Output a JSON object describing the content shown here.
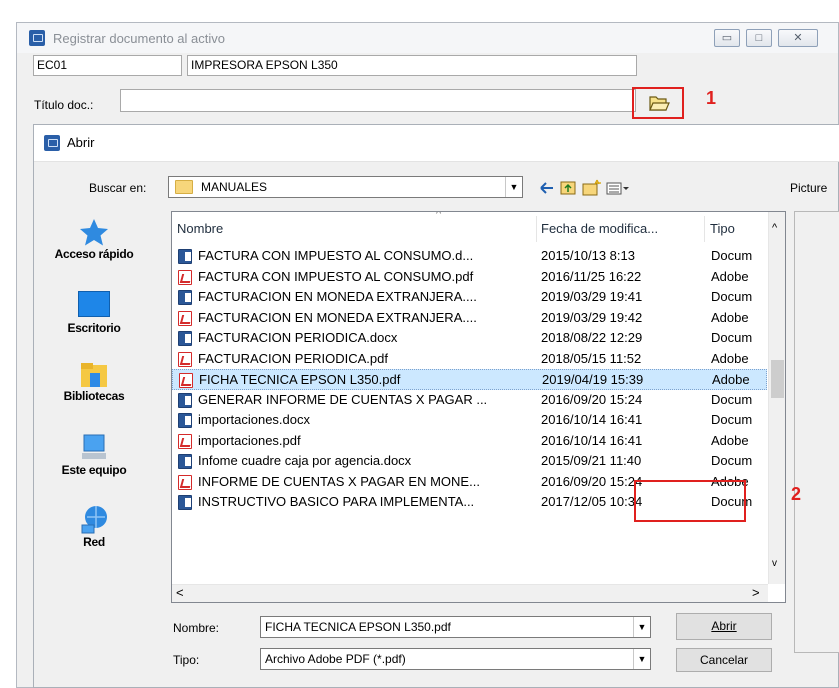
{
  "outer": {
    "title": "Registrar documento al activo",
    "code_value": "EC01",
    "description_value": "IMPRESORA EPSON L350",
    "title_doc_label": "Título doc.:",
    "title_doc_value": "",
    "caption_minimize": "▭",
    "caption_maximize": "□",
    "caption_close": "✕",
    "callout_1": "1",
    "callout_2": "2"
  },
  "dialog": {
    "title": "Abrir",
    "look_in_label": "Buscar en:",
    "look_in_value": "MANUALES",
    "preview_label": "Picture",
    "places": [
      {
        "label": "Acceso rápido",
        "icon": "star-icon"
      },
      {
        "label": "Escritorio",
        "icon": "desktop-icon"
      },
      {
        "label": "Bibliotecas",
        "icon": "libraries-icon"
      },
      {
        "label": "Este equipo",
        "icon": "computer-icon"
      },
      {
        "label": "Red",
        "icon": "network-icon"
      }
    ],
    "columns": {
      "name": "Nombre",
      "date": "Fecha de modifica...",
      "type": "Tipo"
    },
    "files": [
      {
        "name": "FACTURA CON IMPUESTO AL CONSUMO.d...",
        "date": "2015/10/13 8:13",
        "type": "Docum",
        "kind": "docx"
      },
      {
        "name": "FACTURA CON IMPUESTO AL CONSUMO.pdf",
        "date": "2016/11/25 16:22",
        "type": "Adobe",
        "kind": "pdf"
      },
      {
        "name": "FACTURACION EN MONEDA EXTRANJERA....",
        "date": "2019/03/29 19:41",
        "type": "Docum",
        "kind": "docx"
      },
      {
        "name": "FACTURACION EN MONEDA EXTRANJERA....",
        "date": "2019/03/29 19:42",
        "type": "Adobe",
        "kind": "pdf"
      },
      {
        "name": "FACTURACION PERIODICA.docx",
        "date": "2018/08/22 12:29",
        "type": "Docum",
        "kind": "docx"
      },
      {
        "name": "FACTURACION PERIODICA.pdf",
        "date": "2018/05/15 11:52",
        "type": "Adobe",
        "kind": "pdf"
      },
      {
        "name": "FICHA TECNICA EPSON L350.pdf",
        "date": "2019/04/19 15:39",
        "type": "Adobe",
        "kind": "pdf",
        "selected": true
      },
      {
        "name": "GENERAR INFORME DE CUENTAS X PAGAR ...",
        "date": "2016/09/20 15:24",
        "type": "Docum",
        "kind": "docx"
      },
      {
        "name": "importaciones.docx",
        "date": "2016/10/14 16:41",
        "type": "Docum",
        "kind": "docx"
      },
      {
        "name": "importaciones.pdf",
        "date": "2016/10/14 16:41",
        "type": "Adobe",
        "kind": "pdf"
      },
      {
        "name": "Infome cuadre caja por agencia.docx",
        "date": "2015/09/21 11:40",
        "type": "Docum",
        "kind": "docx"
      },
      {
        "name": "INFORME DE CUENTAS X PAGAR EN MONE...",
        "date": "2016/09/20 15:24",
        "type": "Adobe",
        "kind": "pdf"
      },
      {
        "name": "INSTRUCTIVO BASICO PARA IMPLEMENTA...",
        "date": "2017/12/05 10:34",
        "type": "Docum",
        "kind": "docx"
      }
    ],
    "filename_label": "Nombre:",
    "filename_value": "FICHA TECNICA EPSON L350.pdf",
    "filetype_label": "Tipo:",
    "filetype_value": "Archivo Adobe PDF (*.pdf)",
    "open_button": "Abrir",
    "cancel_button": "Cancelar"
  },
  "colors": {
    "highlight": "#e0201e",
    "selection": "#cce8ff"
  }
}
